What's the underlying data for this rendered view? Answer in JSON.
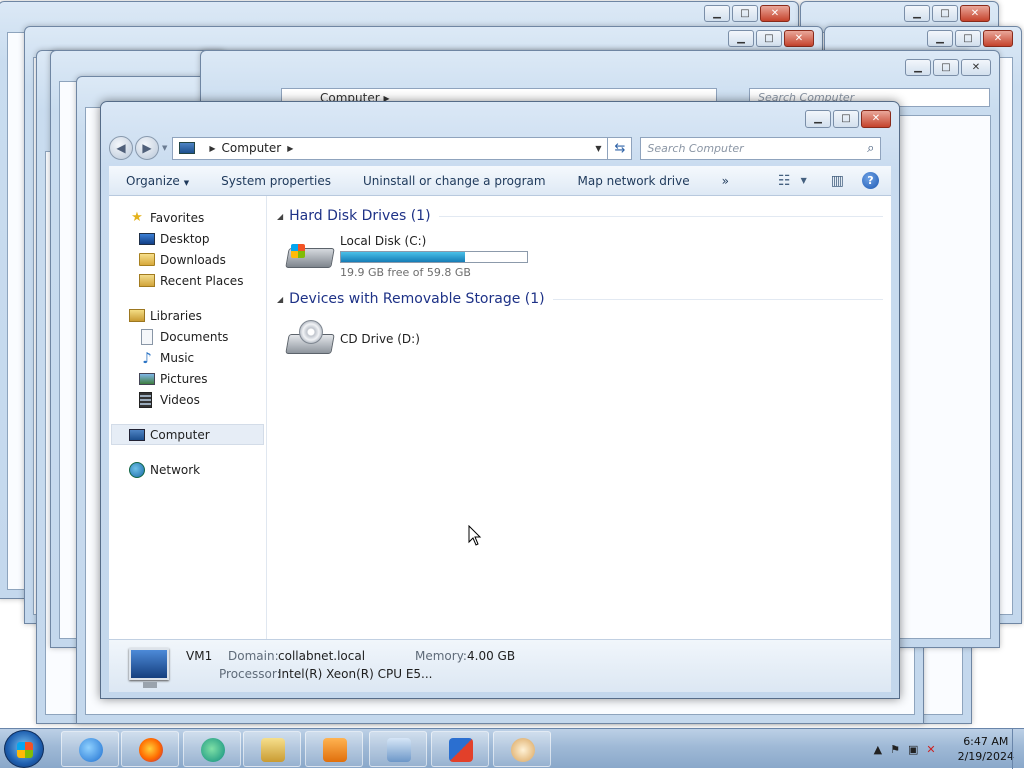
{
  "explorer": {
    "address": {
      "location": "Computer"
    },
    "search": {
      "placeholder": "Search Computer"
    },
    "toolbar": {
      "organize": "Organize",
      "system_properties": "System properties",
      "uninstall": "Uninstall or change a program",
      "map_drive": "Map network drive",
      "more": "»"
    },
    "nav": {
      "favorites": {
        "label": "Favorites",
        "items": [
          "Desktop",
          "Downloads",
          "Recent Places"
        ]
      },
      "libraries": {
        "label": "Libraries",
        "items": [
          "Documents",
          "Music",
          "Pictures",
          "Videos"
        ]
      },
      "computer": "Computer",
      "network": "Network"
    },
    "groups": {
      "hdd": {
        "title": "Hard Disk Drives (1)"
      },
      "removable": {
        "title": "Devices with Removable Storage (1)"
      }
    },
    "drives": {
      "c": {
        "name": "Local Disk (C:)",
        "free_text": "19.9 GB free of 59.8 GB",
        "used_fraction": 0.667
      },
      "d": {
        "name": "CD Drive (D:)"
      }
    },
    "details": {
      "name": "VM1",
      "domain_label": "Domain:",
      "domain": "collabnet.local",
      "memory_label": "Memory:",
      "memory": "4.00 GB",
      "processor_label": "Processor:",
      "processor": "Intel(R) Xeon(R) CPU E5..."
    }
  },
  "background_window": {
    "address": "Computer",
    "search_placeholder": "Search Computer"
  },
  "taskbar": {
    "time": "6:47 AM",
    "date": "2/19/2024"
  }
}
